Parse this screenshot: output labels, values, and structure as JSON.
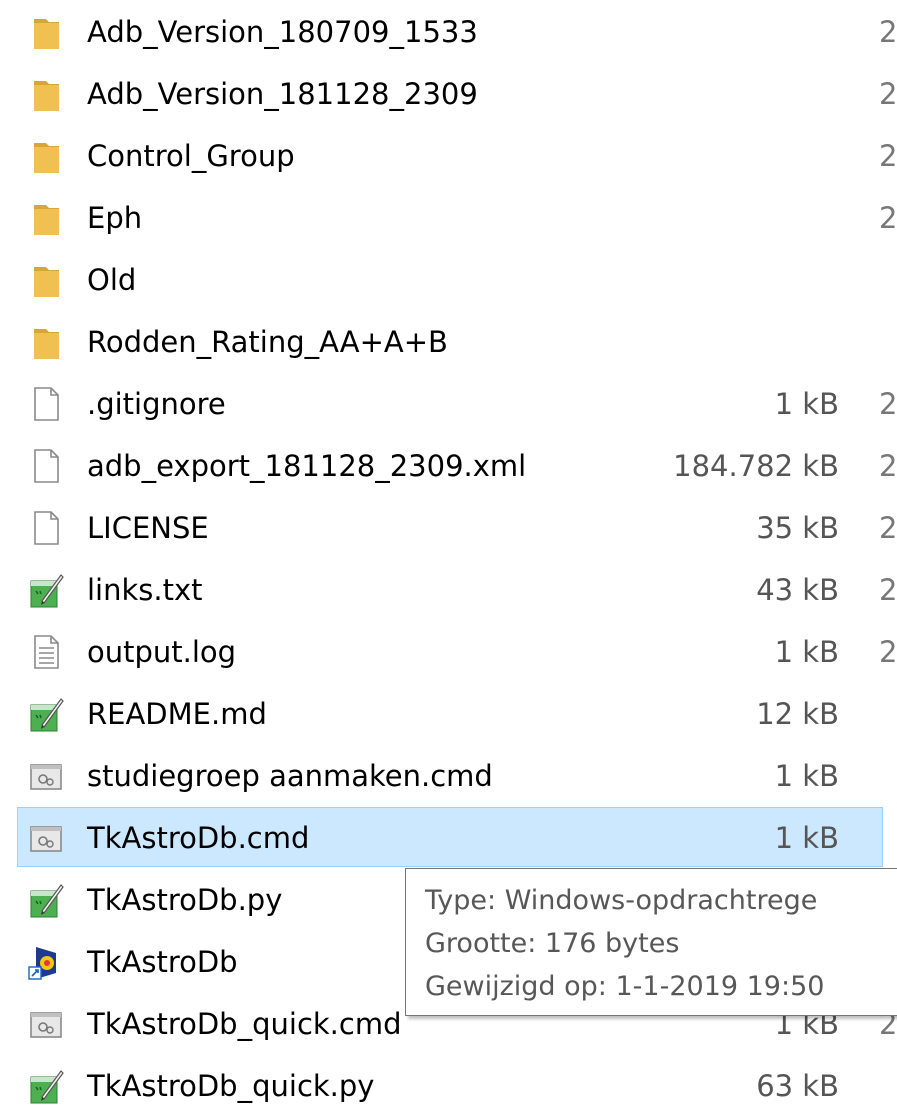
{
  "files": [
    {
      "name": "Adb_Version_180709_1533",
      "size": "",
      "edge": "2",
      "icon": "folder-icon",
      "selected": false
    },
    {
      "name": "Adb_Version_181128_2309",
      "size": "",
      "edge": "2",
      "icon": "folder-icon",
      "selected": false
    },
    {
      "name": "Control_Group",
      "size": "",
      "edge": "2",
      "icon": "folder-icon",
      "selected": false
    },
    {
      "name": "Eph",
      "size": "",
      "edge": "2",
      "icon": "folder-icon",
      "selected": false
    },
    {
      "name": "Old",
      "size": "",
      "edge": "",
      "icon": "folder-icon",
      "selected": false
    },
    {
      "name": "Rodden_Rating_AA+A+B",
      "size": "",
      "edge": "",
      "icon": "folder-icon",
      "selected": false
    },
    {
      "name": ".gitignore",
      "size": "1 kB",
      "edge": "2",
      "icon": "blank-file-icon",
      "selected": false
    },
    {
      "name": "adb_export_181128_2309.xml",
      "size": "184.782 kB",
      "edge": "2",
      "icon": "blank-file-icon",
      "selected": false
    },
    {
      "name": "LICENSE",
      "size": "35 kB",
      "edge": "2",
      "icon": "blank-file-icon",
      "selected": false
    },
    {
      "name": "links.txt",
      "size": "43 kB",
      "edge": "2",
      "icon": "notepad-file-icon",
      "selected": false
    },
    {
      "name": "output.log",
      "size": "1 kB",
      "edge": "2",
      "icon": "text-file-icon",
      "selected": false
    },
    {
      "name": "README.md",
      "size": "12 kB",
      "edge": "",
      "icon": "notepad-file-icon",
      "selected": false
    },
    {
      "name": "studiegroep aanmaken.cmd",
      "size": "1 kB",
      "edge": "",
      "icon": "cmd-file-icon",
      "selected": false
    },
    {
      "name": "TkAstroDb.cmd",
      "size": "1 kB",
      "edge": "",
      "icon": "cmd-file-icon",
      "selected": true
    },
    {
      "name": "TkAstroDb.py",
      "size": "",
      "edge": "",
      "icon": "notepad-file-icon",
      "selected": false
    },
    {
      "name": "TkAstroDb",
      "size": "",
      "edge": "",
      "icon": "shortcut-app-icon",
      "selected": false
    },
    {
      "name": "TkAstroDb_quick.cmd",
      "size": "1 kB",
      "edge": "2",
      "icon": "cmd-file-icon",
      "selected": false
    },
    {
      "name": "TkAstroDb_quick.py",
      "size": "63 kB",
      "edge": "",
      "icon": "notepad-file-icon",
      "selected": false
    }
  ],
  "tooltip": {
    "type": "Type: Windows-opdrachtrege",
    "size": "Grootte: 176 bytes",
    "modified": "Gewijzigd op: 1-1-2019 19:50"
  },
  "colors": {
    "selection_bg": "#cce8ff",
    "selection_border": "#99d1ff",
    "folder": "#e8b64a"
  }
}
